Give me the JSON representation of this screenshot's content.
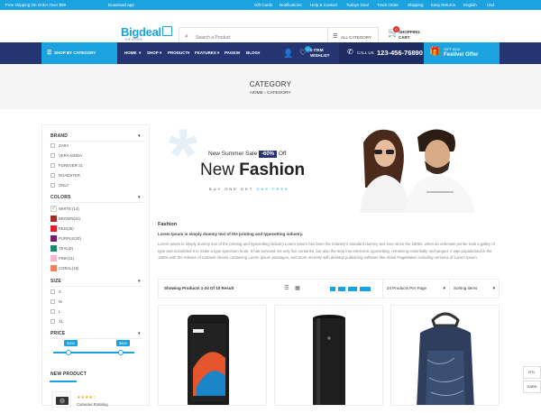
{
  "topbar": {
    "shipping_note": "Free shipping On Order Over $99",
    "download_app": "Download app",
    "links": [
      "Gift Cards",
      "Notifications",
      "Help & Contact",
      "Todays Deal",
      "Track Order",
      "Shipping",
      "Easy Returns",
      "English",
      "Usd"
    ]
  },
  "header": {
    "logo": "Bigdeal",
    "logo_sub": "THE STORE",
    "search_placeholder": "Search a Product",
    "category_select": "ALL CATEGORY",
    "cart_count": "0",
    "cart_label_1": "SHOPPING",
    "cart_label_2": "CART"
  },
  "nav": {
    "shop_by_category": "SHOP BY CATEGORY",
    "menu": [
      "HOME",
      "SHOP",
      "PRODUCT",
      "FEATURES",
      "PAGES",
      "BLOG"
    ],
    "wishlist_count": "0",
    "wishlist_label_1": "0 ITEM",
    "wishlist_label_2": "WISHLIST",
    "call_label": "CALL US",
    "phone": "123-456-76890",
    "gift_label": "GIFT BOX",
    "gift_offer": "Festivel Offer"
  },
  "page": {
    "title": "CATEGORY",
    "breadcrumb_home": "HOME",
    "breadcrumb_sep": "›",
    "breadcrumb_current": "CATEGORY"
  },
  "sidebar": {
    "brand_heading": "BRAND",
    "brands": [
      "ZARA",
      "VERA-MODA",
      "FOREVER-21",
      "ROADSTER",
      "ONLY"
    ],
    "colors_heading": "COLORS",
    "colors": [
      {
        "label": "WHITE (14)",
        "hex": "#ffffff",
        "checked": true
      },
      {
        "label": "BROWN(24)",
        "hex": "#a52a2a"
      },
      {
        "label": "RED(25)",
        "hex": "#e11d2a"
      },
      {
        "label": "PURPLE(20)",
        "hex": "#7a1c6e"
      },
      {
        "label": "TEAL(9)",
        "hex": "#1e8c6a"
      },
      {
        "label": "PINK(11)",
        "hex": "#f7b6c8"
      },
      {
        "label": "CORAL(15)",
        "hex": "#f1805c"
      }
    ],
    "size_heading": "SIZE",
    "sizes": [
      "S",
      "M",
      "L",
      "XL"
    ],
    "price_heading": "PRICE",
    "price_min": "$300",
    "price_max": "$800",
    "new_product_heading": "NEW PRODUCT",
    "new_product_rating": "★★★★☆",
    "new_product_name": "Cameras Rotating"
  },
  "banner": {
    "sale_text": "New Summer Sale",
    "sale_pct": "-60%",
    "sale_off": "Off",
    "headline_1": "New",
    "headline_2": "Fashion",
    "buy_text_1": "BUY ONE GET",
    "buy_text_2": "ONE FREE"
  },
  "description": {
    "heading": "Fashion",
    "bold_line": "Lorem Ipsum is simply dummy text of the printing and typesetting industry.",
    "body": "Lorem Ipsum is simply dummy text of the printing and typesetting industry.Lorem Ipsum has been the industry's standard dummy text ever since the 1500s, when an unknown printer took a galley of type and scrambled it to make a type specimen book. It has survived not only five centuries, but also the leap into electronic typesetting, remaining essentially unchanged. It was popularised in the 1960s with the release of Letraset sheets containing Lorem Ipsum passages, and more recently with desktop publishing software like Aldus PageMaker including versions of Lorem Ipsum."
  },
  "toolbar": {
    "count_text": "Showing Products 1-24 Of 10 Result",
    "per_page": "24 Products Per Page",
    "sorting": "Sorting items"
  },
  "side_tabs": [
    "RTL",
    "DARK"
  ],
  "colors": {
    "accent": "#1ba3e0",
    "nav_bg": "#243572"
  }
}
